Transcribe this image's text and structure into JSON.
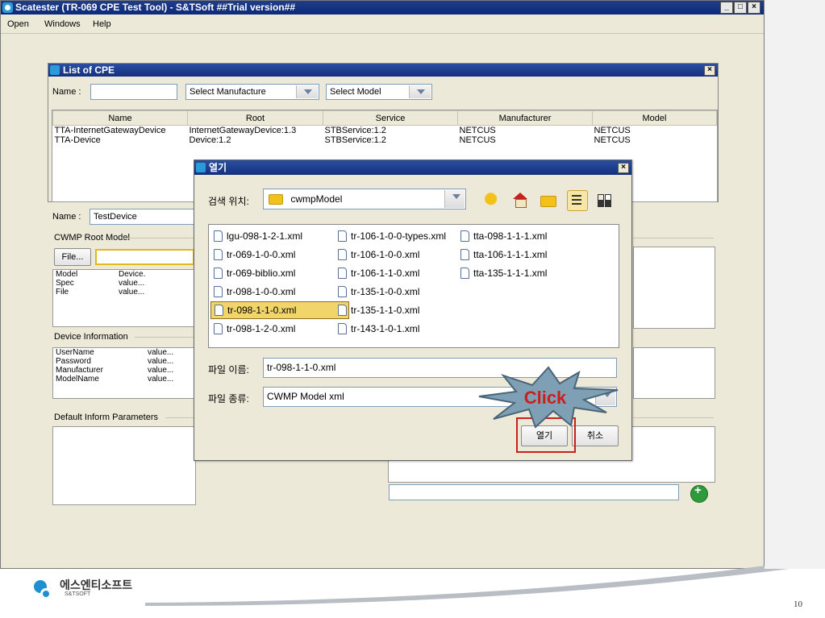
{
  "app": {
    "title": "Scatester (TR-069 CPE Test Tool) - S&TSoft ##Trial version##",
    "menu": [
      "Open",
      "Windows",
      "Help"
    ],
    "window_buttons": [
      "_",
      "□",
      "×"
    ]
  },
  "cpe_list": {
    "title": "List of CPE",
    "name_label": "Name :",
    "name_value": "",
    "manufacture_select": "Select Manufacture",
    "model_select": "Select Model",
    "columns": [
      "Name",
      "Root",
      "Service",
      "Manufacturer",
      "Model"
    ],
    "rows": [
      [
        "TTA-InternetGatewayDevice",
        "InternetGatewayDevice:1.3",
        "STBService:1.2",
        "NETCUS",
        "NETCUS"
      ],
      [
        "TTA-Device",
        "Device:1.2",
        "STBService:1.2",
        "NETCUS",
        "NETCUS"
      ]
    ]
  },
  "device": {
    "name_label": "Name :",
    "name_value": "TestDevice",
    "root_model_group": "CWMP Root Model",
    "file_button": "File...",
    "root_model_rows": [
      [
        "Model",
        "Device."
      ],
      [
        "Spec",
        "value..."
      ],
      [
        "File",
        "value..."
      ]
    ],
    "device_info_group": "Device Information",
    "device_info_rows": [
      [
        "UserName",
        "value..."
      ],
      [
        "Password",
        "value..."
      ],
      [
        "Manufacturer",
        "value..."
      ],
      [
        "ModelName",
        "value..."
      ]
    ],
    "inform_group": "Default Inform Parameters"
  },
  "dialog": {
    "title": "열기",
    "look_in_label": "검색 위치:",
    "look_in_value": "cwmpModel",
    "files": [
      "lgu-098-1-2-1.xml",
      "tr-069-1-0-0.xml",
      "tr-069-biblio.xml",
      "tr-098-1-0-0.xml",
      "tr-098-1-1-0.xml",
      "tr-098-1-2-0.xml",
      "tr-106-1-0-0-types.xml",
      "tr-106-1-0-0.xml",
      "tr-106-1-1-0.xml",
      "tr-135-1-0-0.xml",
      "tr-135-1-1-0.xml",
      "tr-143-1-0-1.xml",
      "tta-098-1-1-1.xml",
      "tta-106-1-1-1.xml",
      "tta-135-1-1-1.xml"
    ],
    "selected_file": "tr-098-1-1-0.xml",
    "filename_label": "파일 이름:",
    "filename_value": "tr-098-1-1-0.xml",
    "filetype_label": "파일 종류:",
    "filetype_value": "CWMP Model xml",
    "open_button": "열기",
    "cancel_button": "취소",
    "toolbar_icons": [
      "up-folder-icon",
      "home-icon",
      "new-folder-icon",
      "list-view-icon",
      "details-view-icon"
    ]
  },
  "callout": "Click",
  "footer": {
    "company": "에스엔티소프트",
    "company_sub": "S&TSOFT",
    "page_number": "10"
  },
  "colors": {
    "titlebar": "#0c2a78",
    "window_bg": "#ece9d8",
    "selection": "#f1d46a",
    "callout_text": "#c8201c",
    "callout_fill": "#7fa0b4"
  }
}
